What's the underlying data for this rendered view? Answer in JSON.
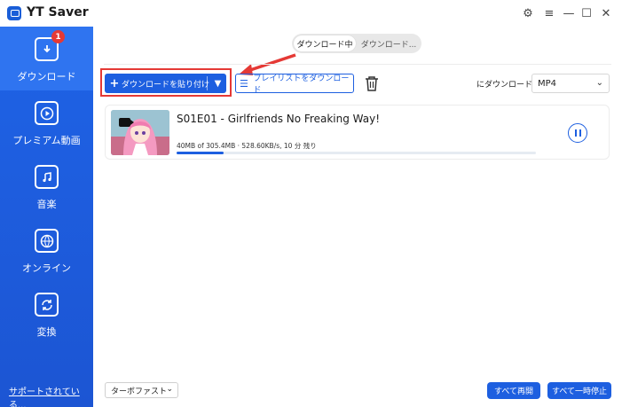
{
  "app": {
    "title": "YT Saver"
  },
  "window_controls": {
    "settings_icon": "gear-icon",
    "menu_icon": "hamburger-icon",
    "minimize_icon": "minimize-icon",
    "maximize_icon": "maximize-icon",
    "close_icon": "close-icon"
  },
  "sidebar": {
    "items": [
      {
        "label": "ダウンロード",
        "icon": "download-icon",
        "badge": "1",
        "active": true
      },
      {
        "label": "プレミアム動画",
        "icon": "play-icon"
      },
      {
        "label": "音楽",
        "icon": "music-icon"
      },
      {
        "label": "オンライン",
        "icon": "globe-icon"
      },
      {
        "label": "変換",
        "icon": "convert-icon"
      }
    ],
    "support_link": "サポートされている..."
  },
  "tabs": {
    "downloading": "ダウンロード中",
    "downloaded": "ダウンロード..."
  },
  "toolbar": {
    "paste_label": "ダウンロードを貼り付け",
    "playlist_label": "プレイリストをダウンロード",
    "format_prefix": "にダウンロード",
    "format_value": "MP4"
  },
  "downloads": [
    {
      "title": "S01E01 - Girlfriends No Freaking Way!",
      "progress_text": "40MB of 305.4MB ·  528.60KB/s, 10 分 残り",
      "progress": 0.13
    }
  ],
  "footer": {
    "turbo_label": "ターボファスト",
    "resume_all": "すべて再開",
    "pause_all": "すべて一時停止"
  },
  "colors": {
    "accent": "#1d5fe0",
    "sidebar": "#1f63e6",
    "highlight": "#e53935"
  }
}
